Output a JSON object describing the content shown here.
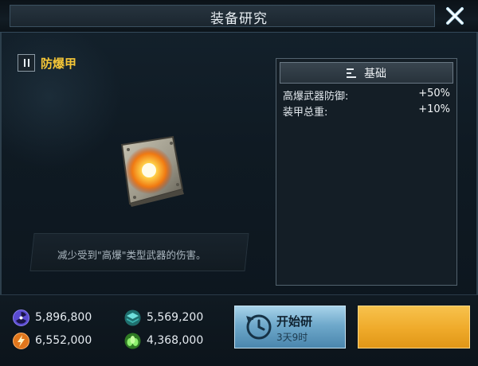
{
  "window": {
    "title": "装备研究",
    "close_icon": "close-x-icon"
  },
  "item": {
    "name": "防爆甲",
    "badge_icon": "pause-icon",
    "image_icon": "armor-plate-explosion-icon",
    "description": "减少受到\"高爆\"类型武器的伤害。"
  },
  "stats": {
    "header": "基础",
    "header_icon": "list-icon",
    "rows": [
      {
        "label": "高爆武器防御:",
        "value": "+50%"
      },
      {
        "label": "装甲总重:",
        "value": "+10%"
      }
    ]
  },
  "resources": [
    {
      "icon": "radiation-icon",
      "value": "5,896,800",
      "color": "#5a4bd1"
    },
    {
      "icon": "layers-icon",
      "value": "5,569,200",
      "color": "#2fa9a6"
    },
    {
      "icon": "energy-bolt-icon",
      "value": "6,552,000",
      "color": "#e0761c"
    },
    {
      "icon": "plant-icon",
      "value": "4,368,000",
      "color": "#4fbf3a"
    }
  ],
  "actions": {
    "start_label": "开始研",
    "start_time": "3天9时",
    "start_icon": "clock-icon",
    "accent_blue": "#6fa9cb",
    "accent_gold": "#efaa2a"
  }
}
